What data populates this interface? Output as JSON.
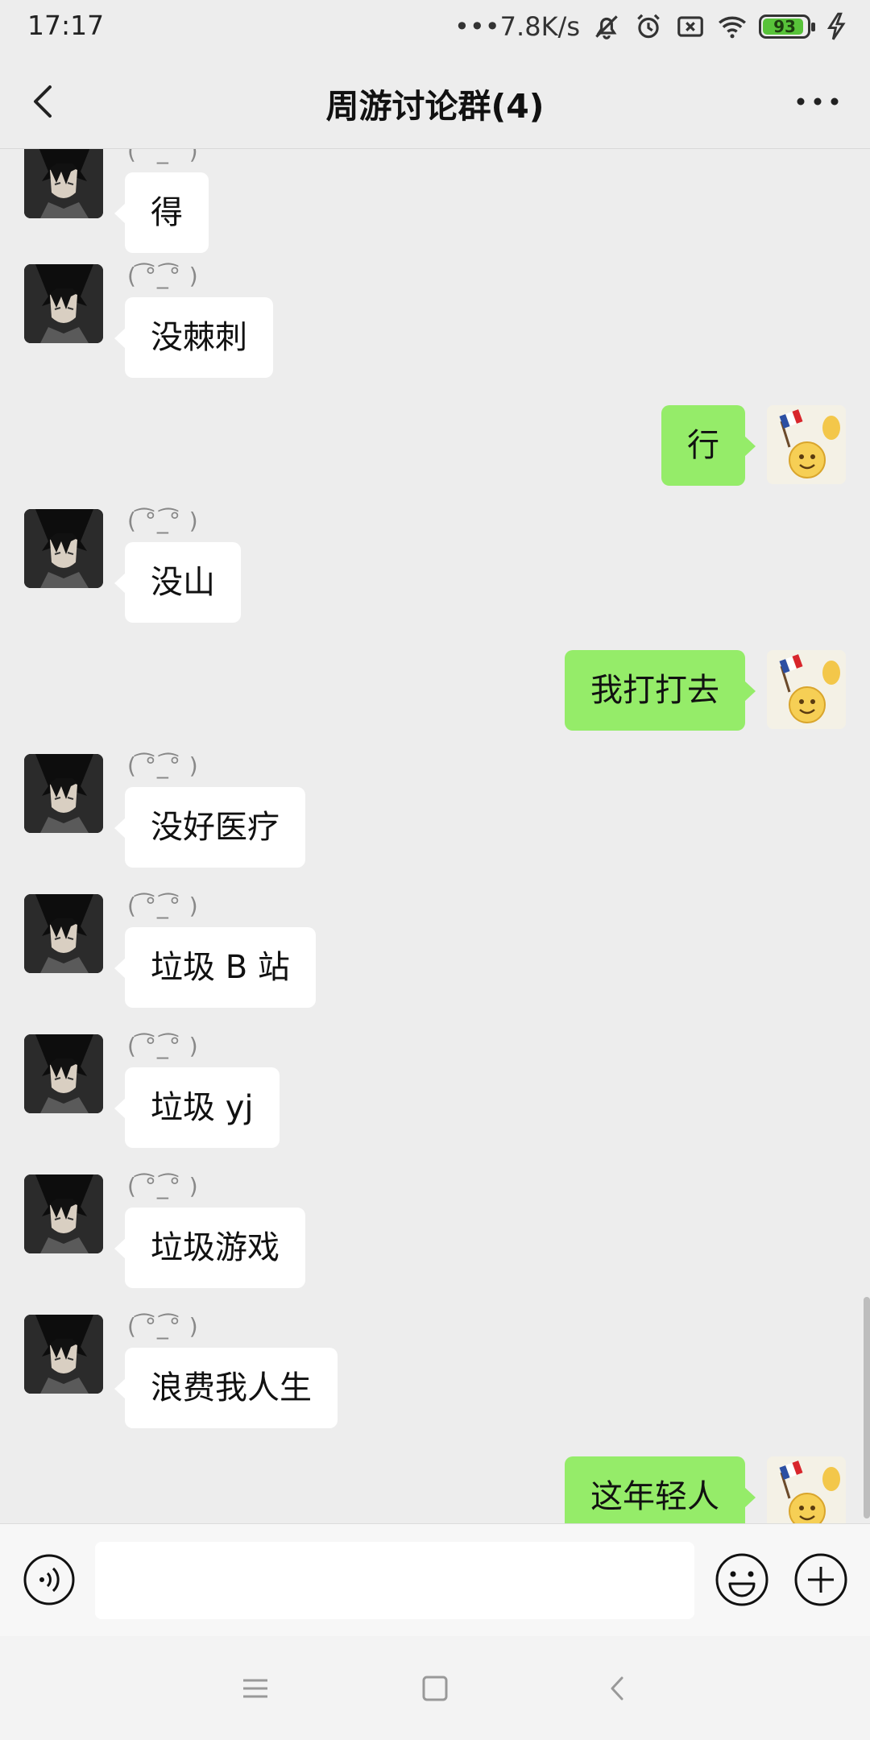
{
  "status": {
    "time": "17:17",
    "net_speed": "•••7.8K/s",
    "battery": "93",
    "icons": [
      "mute-bell-icon",
      "alarm-icon",
      "sim-x-icon",
      "wifi-icon",
      "battery-icon",
      "charging-icon"
    ]
  },
  "header": {
    "title": "周游讨论群(4)",
    "back_icon": "chevron-left-icon",
    "more_icon": "more-dots-icon"
  },
  "sender_name": "( ͡°_͡° )",
  "messages": [
    {
      "side": "in",
      "text": "得"
    },
    {
      "side": "in",
      "text": "没棘刺"
    },
    {
      "side": "out",
      "text": "行"
    },
    {
      "side": "in",
      "text": "没山"
    },
    {
      "side": "out",
      "text": "我打打去"
    },
    {
      "side": "in",
      "text": "没好医疗"
    },
    {
      "side": "in",
      "text": "垃圾 B 站"
    },
    {
      "side": "in",
      "text": "垃圾 yj"
    },
    {
      "side": "in",
      "text": "垃圾游戏"
    },
    {
      "side": "in",
      "text": "浪费我人生"
    },
    {
      "side": "out",
      "text": "这年轻人"
    }
  ],
  "input": {
    "value": "",
    "voice_icon": "voice-icon",
    "emoji_icon": "emoji-icon",
    "plus_icon": "plus-icon"
  },
  "nav": {
    "icons": [
      "menu-icon",
      "home-icon",
      "back-icon"
    ]
  },
  "colors": {
    "background": "#ededed",
    "out_bubble": "#95ec69",
    "in_bubble": "#ffffff"
  }
}
